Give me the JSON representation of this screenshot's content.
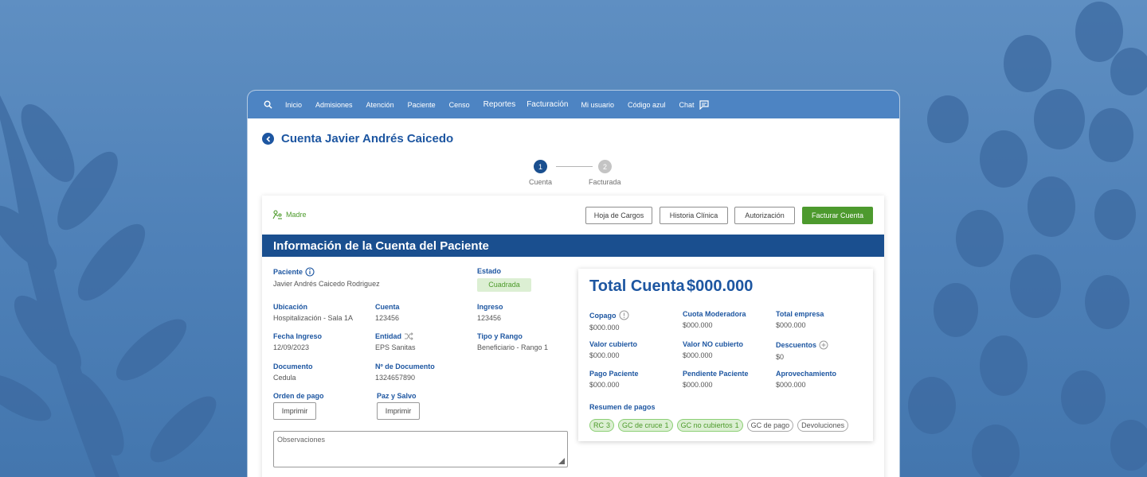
{
  "nav": {
    "items": [
      "Inicio",
      "Admisiones",
      "Atención",
      "Paciente",
      "Censo"
    ],
    "reports": "Reportes",
    "billing": "Facturación",
    "user": "Mi usuario",
    "code_blue": "Código azul",
    "chat": "Chat"
  },
  "page": {
    "title": "Cuenta Javier Andrés Caicedo"
  },
  "stepper": {
    "steps": [
      {
        "num": "1",
        "label": "Cuenta",
        "active": true
      },
      {
        "num": "2",
        "label": "Facturada",
        "active": false
      }
    ]
  },
  "actions": {
    "madre": "Madre",
    "hoja_cargos": "Hoja de Cargos",
    "historia": "Historia Clínica",
    "autorizacion": "Autorización",
    "facturar": "Facturar Cuenta"
  },
  "section": {
    "title": "Información de la Cuenta del Paciente"
  },
  "patient": {
    "paciente_label": "Paciente",
    "paciente_value": "Javier Andrés Caicedo Rodriguez",
    "estado_label": "Estado",
    "estado_value": "Cuadrada",
    "ubicacion_label": "Ubicación",
    "ubicacion_value": "Hospitalización - Sala 1A",
    "cuenta_label": "Cuenta",
    "cuenta_value": "123456",
    "ingreso_label": "Ingreso",
    "ingreso_value": "123456",
    "fecha_label": "Fecha Ingreso",
    "fecha_value": "12/09/2023",
    "entidad_label": "Entidad",
    "entidad_value": "EPS Sanitas",
    "tipo_label": "Tipo y Rango",
    "tipo_value": "Beneficiario - Rango 1",
    "documento_label": "Documento",
    "documento_value": "Cedula",
    "ndoc_label": "Nº de Documento",
    "ndoc_value": "1324657890",
    "orden_label": "Orden de pago",
    "paz_label": "Paz y Salvo",
    "imprimir": "Imprimir",
    "observaciones": "Observaciones"
  },
  "totals": {
    "title": "Total Cuenta",
    "amount": "$000.000",
    "copago_label": "Copago",
    "copago_value": "$000.000",
    "cuota_label": "Cuota Moderadora",
    "cuota_value": "$000.000",
    "empresa_label": "Total empresa",
    "empresa_value": "$000.000",
    "cubierto_label": "Valor cubierto",
    "cubierto_value": "$000.000",
    "no_cubierto_label": "Valor NO cubierto",
    "no_cubierto_value": "$000.000",
    "descuentos_label": "Descuentos",
    "descuentos_value": "$0",
    "pago_label": "Pago Paciente",
    "pago_value": "$000.000",
    "pendiente_label": "Pendiente Paciente",
    "pendiente_value": "$000.000",
    "aprovechamiento_label": "Aprovechamiento",
    "aprovechamiento_value": "$000.000",
    "resumen_label": "Resumen de pagos"
  },
  "chips": [
    {
      "label": "RC",
      "count": "3",
      "green": true
    },
    {
      "label": "GC de cruce",
      "count": "1",
      "green": true
    },
    {
      "label": "GC no cubiertos",
      "count": "1",
      "green": true
    },
    {
      "label": "GC de pago",
      "count": "",
      "green": false
    },
    {
      "label": "Devoluciones",
      "count": "",
      "green": false
    }
  ],
  "colors": {
    "primary": "#1d56a1",
    "nav": "#4d84c3",
    "section": "#1a4f8f",
    "accent_green": "#4d9a2e",
    "background": "#5585bb"
  }
}
